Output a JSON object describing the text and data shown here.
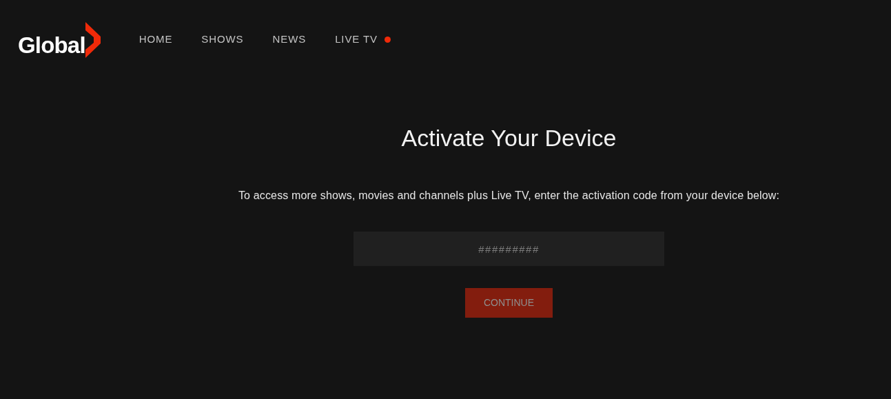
{
  "logo": {
    "text": "Global"
  },
  "nav": [
    {
      "label": "HOME",
      "live": false
    },
    {
      "label": "SHOWS",
      "live": false
    },
    {
      "label": "NEWS",
      "live": false
    },
    {
      "label": "LIVE TV",
      "live": true
    }
  ],
  "title": "Activate Your Device",
  "description": "To access more shows, movies and channels plus Live TV, enter the activation code from your device below:",
  "code_field": {
    "placeholder": "#########"
  },
  "continue_button": {
    "label": "CONTINUE",
    "disabled": true
  }
}
